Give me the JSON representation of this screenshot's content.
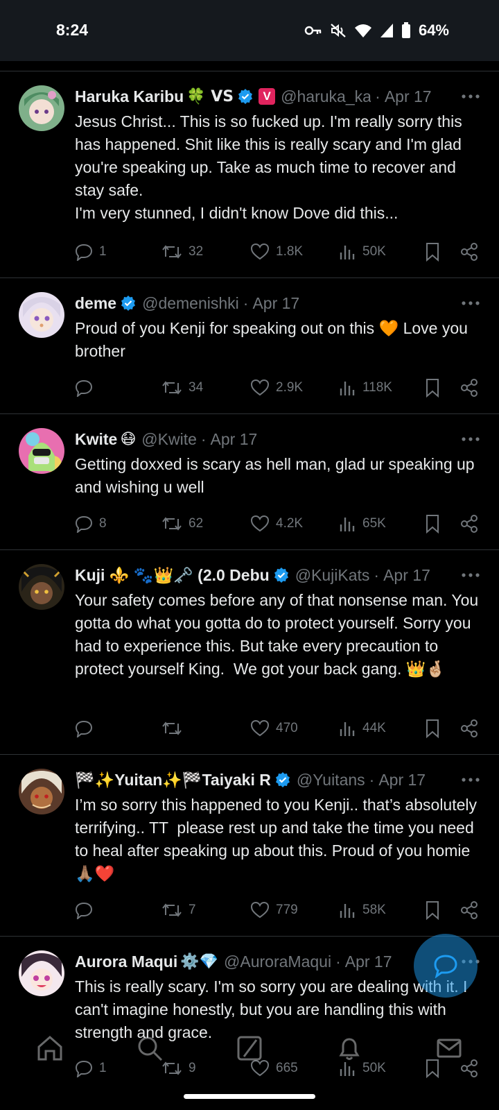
{
  "status_bar": {
    "time": "8:24",
    "battery": "64%",
    "icons": [
      "key-icon",
      "mute-icon",
      "wifi-icon",
      "signal-icon",
      "battery-icon"
    ]
  },
  "tweets": [
    {
      "name": "Haruka Karibu",
      "name_emoji": "🍀 VS",
      "verified": true,
      "extra_badge": "V",
      "handle": "@haruka_ka",
      "sep": "·",
      "date": "Apr 17",
      "text": "Jesus Christ... This is so fucked up. I'm really sorry this has happened. Shit like this is really scary and I'm glad you're speaking up. Take as much time to recover and stay safe.\nI'm very stunned, I didn't know Dove did this...",
      "replies": "1",
      "retweets": "32",
      "likes": "1.8K",
      "views": "50K"
    },
    {
      "name": "deme",
      "name_emoji": "",
      "verified": true,
      "handle": "@demenishki",
      "sep": "·",
      "date": "Apr 17",
      "text": "Proud of you Kenji for speaking out on this 🧡 Love you brother",
      "replies": "",
      "retweets": "34",
      "likes": "2.9K",
      "views": "118K"
    },
    {
      "name": "Kwite",
      "name_emoji": "😷",
      "verified": false,
      "handle": "@Kwite",
      "sep": "·",
      "date": "Apr 17",
      "text": "Getting doxxed is scary as hell man, glad ur speaking up and wishing u well",
      "replies": "8",
      "retweets": "62",
      "likes": "4.2K",
      "views": "65K"
    },
    {
      "name": "Kuji ⚜️ 🐾👑🗝️ (2.0 Debu",
      "name_emoji": "",
      "verified": true,
      "handle": "@KujiKats",
      "sep": "·",
      "date": "Apr 17",
      "text": "Your safety comes before any of that nonsense man. You gotta do what you gotta do to protect yourself. Sorry you had to experience this. But take every precaution to protect yourself King.  We got your back gang. 👑🤞🏼",
      "replies": "",
      "retweets": "",
      "likes": "470",
      "views": "44K"
    },
    {
      "name": "🏁✨Yuitan✨🏁Taiyaki R",
      "name_emoji": "",
      "verified": true,
      "handle": "@Yuitans",
      "sep": "·",
      "date": "Apr 17",
      "text": "I’m so sorry this happened to you Kenji.. that’s absolutely terrifying.. TT  please rest up and take the time you need to heal after speaking up about this. Proud of you homie🙏🏽❤️",
      "replies": "",
      "retweets": "7",
      "likes": "779",
      "views": "58K"
    },
    {
      "name": "Aurora Maqui",
      "name_emoji": "⚙️💎",
      "verified": false,
      "handle": "@AuroraMaqui",
      "sep": "·",
      "date": "Apr 17",
      "text": "This is really scary. I'm so sorry you are dealing with it. I can't imagine honestly, but you are handling this with strength and grace.",
      "replies": "1",
      "retweets": "9",
      "likes": "665",
      "views": "50K"
    }
  ],
  "nav": [
    "home-icon",
    "search-icon",
    "grok-icon",
    "notifications-icon",
    "messages-icon"
  ],
  "colors": {
    "background": "#000000",
    "text": "#e7e9ea",
    "muted": "#71767b",
    "divider": "#2f3336",
    "verified": "#1d9bf0"
  }
}
